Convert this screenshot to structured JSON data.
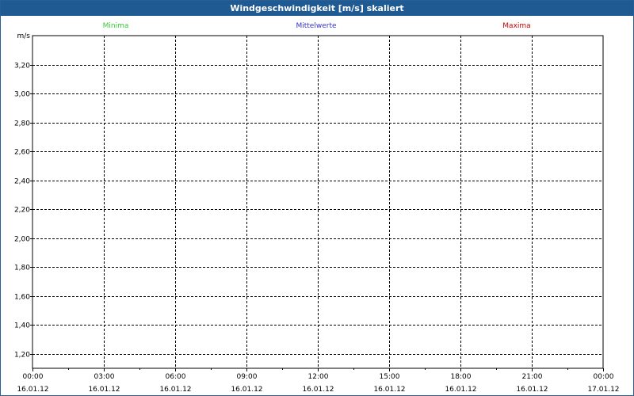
{
  "window": {
    "title": "Windgeschwindigkeit [m/s] skaliert"
  },
  "chart_data": {
    "type": "line",
    "unit_label": "m/s",
    "legend": [
      {
        "name": "Minima",
        "color": "#33cc33"
      },
      {
        "name": "Mittelwerte",
        "color": "#3333cc"
      },
      {
        "name": "Maxima",
        "color": "#cc0000"
      }
    ],
    "ylim": [
      1.1,
      3.4
    ],
    "y_ticks": [
      3.2,
      3.0,
      2.8,
      2.6,
      2.4,
      2.2,
      2.0,
      1.8,
      1.6,
      1.4,
      1.2
    ],
    "y_tick_labels": [
      "3,20",
      "3,00",
      "2,80",
      "2,60",
      "2,40",
      "2,20",
      "2,00",
      "1,80",
      "1,60",
      "1,40",
      "1,20"
    ],
    "x_ticks": [
      {
        "time": "00:00",
        "date": "16.01.12"
      },
      {
        "time": "03:00",
        "date": "16.01.12"
      },
      {
        "time": "06:00",
        "date": "16.01.12"
      },
      {
        "time": "09:00",
        "date": "16.01.12"
      },
      {
        "time": "12:00",
        "date": "16.01.12"
      },
      {
        "time": "15:00",
        "date": "16.01.12"
      },
      {
        "time": "18:00",
        "date": "16.01.12"
      },
      {
        "time": "21:00",
        "date": "16.01.12"
      },
      {
        "time": "00:00",
        "date": "17.01.12"
      }
    ],
    "grid": true,
    "series": [
      {
        "name": "Minima",
        "values": []
      },
      {
        "name": "Mittelwerte",
        "values": []
      },
      {
        "name": "Maxima",
        "values": []
      }
    ]
  }
}
